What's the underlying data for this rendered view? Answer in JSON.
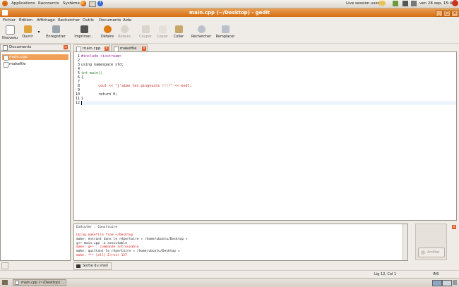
{
  "top_panel": {
    "menus": [
      "Applications",
      "Raccourcis",
      "Système"
    ],
    "session": "Live session user",
    "datetime": "ven 28 sep, 15:48"
  },
  "window": {
    "title": "main.cpp (~/Desktop) - gedit"
  },
  "menubar": [
    "Fichier",
    "Édition",
    "Affichage",
    "Rechercher",
    "Outils",
    "Documents",
    "Aide"
  ],
  "toolbar": {
    "new": "Nouveau",
    "open": "Ouvrir",
    "save": "Enregistrer",
    "print": "Imprimer...",
    "undo": "Défaire",
    "redo": "Refaire",
    "cut": "Couper",
    "copy": "Copier",
    "paste": "Coller",
    "find": "Rechercher",
    "replace": "Remplacer"
  },
  "side_panel": {
    "title": "Documents",
    "documents": [
      "main.cpp",
      "makefile"
    ]
  },
  "tabs": [
    "main.cpp",
    "makefile"
  ],
  "editor": {
    "lines": [
      {
        "n": "1",
        "text": "#include <iostream>"
      },
      {
        "n": "2",
        "text": ""
      },
      {
        "n": "3",
        "text": "using namespace std;"
      },
      {
        "n": "4",
        "text": ""
      },
      {
        "n": "5",
        "text": "int main()"
      },
      {
        "n": "6",
        "text": "{"
      },
      {
        "n": "7",
        "text": ""
      },
      {
        "n": "8",
        "text": "        cout << \"j'aime les pingouins !!!!\" << endl;"
      },
      {
        "n": "9",
        "text": ""
      },
      {
        "n": "10",
        "text": "        return 0;"
      },
      {
        "n": "11",
        "text": "}"
      },
      {
        "n": "12",
        "text": ""
      }
    ]
  },
  "output": {
    "lines": [
      "Exécuter : Construire",
      "",
      "Using makefile from ~/Desktop",
      "make: entrant dans le répertoire « /home/ubuntu/Desktop »",
      "g++ main.cpp -o executable",
      "make: g++ : commande introuvable",
      "make: quittant le répertoire « /home/ubuntu/Desktop »",
      "make: *** [all] Erreur 127"
    ],
    "stop_button": "Arrêter",
    "shell_tab": "Sortie du shell"
  },
  "status": {
    "position": "Lig 12, Col 1",
    "mode": "INS"
  },
  "taskbar": {
    "task": "main.cpp (~/Desktop) ..."
  },
  "colors": {
    "accent": "#d46d12",
    "selection": "#f1a05a",
    "keyword": "#a020a0",
    "string": "#d21",
    "error": "#d22"
  }
}
